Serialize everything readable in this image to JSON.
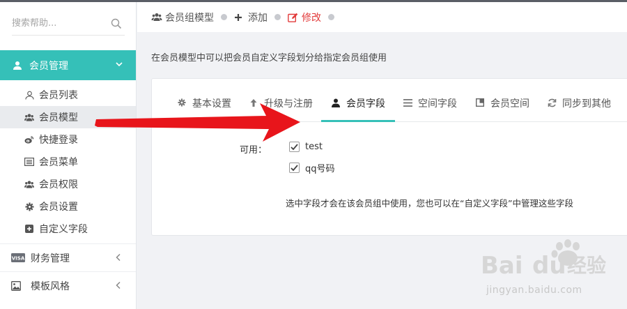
{
  "sidebar": {
    "search_placeholder": "搜索帮助...",
    "active_menu": {
      "label": "会员管理",
      "icon": "user-icon"
    },
    "subitems": [
      {
        "label": "会员列表",
        "icon": "user-outline-icon"
      },
      {
        "label": "会员模型",
        "icon": "users-icon",
        "selected": true
      },
      {
        "label": "快捷登录",
        "icon": "weibo-icon"
      },
      {
        "label": "会员菜单",
        "icon": "list-icon"
      },
      {
        "label": "会员权限",
        "icon": "users-icon"
      },
      {
        "label": "会员设置",
        "icon": "gear-icon"
      },
      {
        "label": "自定义字段",
        "icon": "plus-square-icon"
      }
    ],
    "menus": [
      {
        "label": "财务管理",
        "icon": "visa-icon"
      },
      {
        "label": "模板风格",
        "icon": "image-icon"
      }
    ]
  },
  "breadcrumb": {
    "items": [
      {
        "label": "会员组模型",
        "icon": "users-icon"
      },
      {
        "label": "添加",
        "icon": "plus-icon"
      },
      {
        "label": "修改",
        "icon": "edit-icon",
        "active": true
      }
    ]
  },
  "description": "在会员模型中可以把会员自定义字段划分给指定会员组使用",
  "tabs": [
    {
      "label": "基本设置",
      "icon": "gear-icon"
    },
    {
      "label": "升级与注册",
      "icon": "arrow-up-icon"
    },
    {
      "label": "会员字段",
      "icon": "user-icon",
      "active": true
    },
    {
      "label": "空间字段",
      "icon": "bars-icon"
    },
    {
      "label": "会员空间",
      "icon": "window-icon"
    },
    {
      "label": "同步到其他",
      "icon": "refresh-icon"
    }
  ],
  "form": {
    "available_label": "可用：",
    "fields": [
      {
        "label": "test",
        "checked": true
      },
      {
        "label": "qq号码",
        "checked": true
      }
    ],
    "hint": "选中字段才会在该会员组中使用，您也可以在“自定义字段”中管理这些字段"
  },
  "watermark": {
    "logo_text": "Bai du 经验",
    "url": "jingyan.baidu.com"
  },
  "colors": {
    "accent": "#35c0b8",
    "active_breadcrumb": "#e23b3b",
    "annotation_arrow": "#e8151b"
  }
}
